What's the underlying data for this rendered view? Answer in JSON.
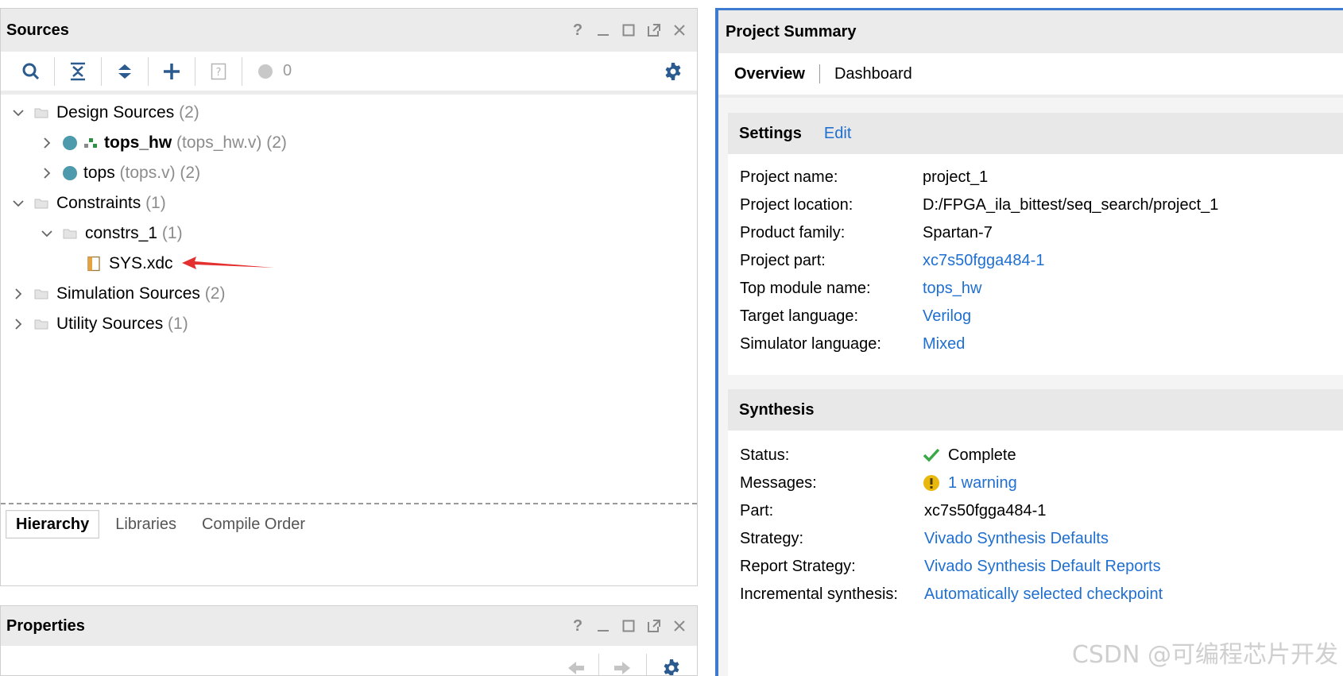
{
  "sources": {
    "title": "Sources",
    "error_count": "0",
    "tree": {
      "design_sources": {
        "label": "Design Sources",
        "count": "(2)"
      },
      "tops_hw": {
        "name": "tops_hw",
        "file": "(tops_hw.v)",
        "count": "(2)"
      },
      "tops": {
        "name": "tops",
        "file": "(tops.v)",
        "count": "(2)"
      },
      "constraints": {
        "label": "Constraints",
        "count": "(1)"
      },
      "constrs_1": {
        "label": "constrs_1",
        "count": "(1)"
      },
      "sys_xdc": {
        "label": "SYS.xdc"
      },
      "simulation_sources": {
        "label": "Simulation Sources",
        "count": "(2)"
      },
      "utility_sources": {
        "label": "Utility Sources",
        "count": "(1)"
      }
    },
    "tabs": [
      "Hierarchy",
      "Libraries",
      "Compile Order"
    ]
  },
  "properties": {
    "title": "Properties"
  },
  "summary": {
    "title": "Project Summary",
    "tabs": {
      "overview": "Overview",
      "dashboard": "Dashboard"
    },
    "settings": {
      "heading": "Settings",
      "edit": "Edit",
      "rows": [
        {
          "k": "Project name:",
          "v": "project_1"
        },
        {
          "k": "Project location:",
          "v": "D:/FPGA_ila_bittest/seq_search/project_1"
        },
        {
          "k": "Product family:",
          "v": "Spartan-7"
        },
        {
          "k": "Project part:",
          "v": "xc7s50fgga484-1"
        },
        {
          "k": "Top module name:",
          "v": "tops_hw"
        },
        {
          "k": "Target language:",
          "v": "Verilog"
        },
        {
          "k": "Simulator language:",
          "v": "Mixed"
        }
      ]
    },
    "synthesis": {
      "heading": "Synthesis",
      "rows": [
        {
          "k": "Status:",
          "v": "Complete"
        },
        {
          "k": "Messages:",
          "v": "1 warning"
        },
        {
          "k": "Part:",
          "v": "xc7s50fgga484-1"
        },
        {
          "k": "Strategy:",
          "v": "Vivado Synthesis Defaults"
        },
        {
          "k": "Report Strategy:",
          "v": "Vivado Synthesis Default Reports"
        },
        {
          "k": "Incremental synthesis:",
          "v": "Automatically selected checkpoint"
        }
      ]
    }
  },
  "watermark": "CSDN @可编程芯片开发",
  "colors": {
    "accent": "#3d7bd1",
    "link": "#1f6fd1",
    "ok": "#3aa847",
    "warn": "#e8b90c",
    "arrow": "#e3302f"
  }
}
